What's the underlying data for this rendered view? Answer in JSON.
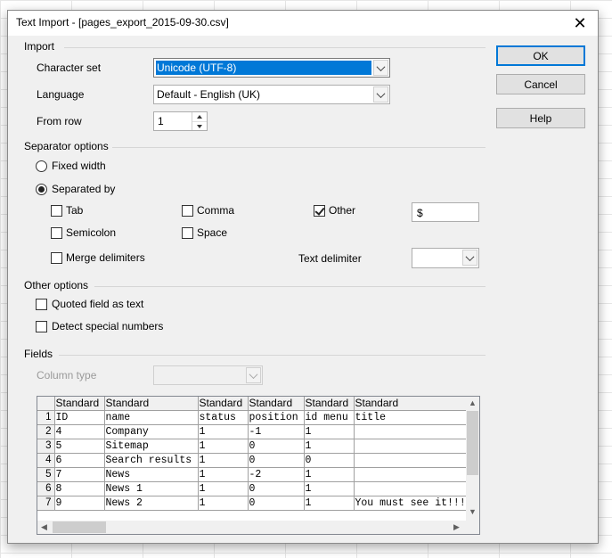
{
  "window": {
    "title": "Text Import - [pages_export_2015-09-30.csv]",
    "close_glyph": "✕"
  },
  "import": {
    "section_label": "Import",
    "charset_label": "Character set",
    "charset_value": "Unicode (UTF-8)",
    "language_label": "Language",
    "language_value": "Default - English (UK)",
    "from_row_label": "From row",
    "from_row_value": "1"
  },
  "separator": {
    "section_label": "Separator options",
    "fixed_width_label": "Fixed width",
    "separated_by_label": "Separated by",
    "tab_label": "Tab",
    "comma_label": "Comma",
    "other_label": "Other",
    "other_value": "$",
    "semicolon_label": "Semicolon",
    "space_label": "Space",
    "merge_label": "Merge delimiters",
    "text_delimiter_label": "Text delimiter",
    "text_delimiter_value": ""
  },
  "other": {
    "section_label": "Other options",
    "quoted_label": "Quoted field as text",
    "detect_label": "Detect special numbers"
  },
  "fields": {
    "section_label": "Fields",
    "column_type_label": "Column type",
    "column_type_value": "",
    "headers": [
      "Standard",
      "Standard",
      "Standard",
      "Standard",
      "Standard",
      "Standard"
    ],
    "rows": [
      {
        "n": "1",
        "c": [
          "ID",
          "name",
          "status",
          "position",
          "id menu",
          "title"
        ]
      },
      {
        "n": "2",
        "c": [
          "4",
          "Company",
          "1",
          "-1",
          "1",
          ""
        ]
      },
      {
        "n": "3",
        "c": [
          "5",
          "Sitemap",
          "1",
          "0",
          "1",
          ""
        ]
      },
      {
        "n": "4",
        "c": [
          "6",
          "Search results",
          "1",
          "0",
          "0",
          ""
        ]
      },
      {
        "n": "5",
        "c": [
          "7",
          "News",
          "1",
          "-2",
          "1",
          ""
        ]
      },
      {
        "n": "6",
        "c": [
          "8",
          "News 1",
          "1",
          "0",
          "1",
          ""
        ]
      },
      {
        "n": "7",
        "c": [
          "9",
          "News 2",
          "1",
          "0",
          "1",
          "You must see it!!!"
        ]
      }
    ]
  },
  "buttons": {
    "ok": "OK",
    "cancel": "Cancel",
    "help": "Help"
  }
}
